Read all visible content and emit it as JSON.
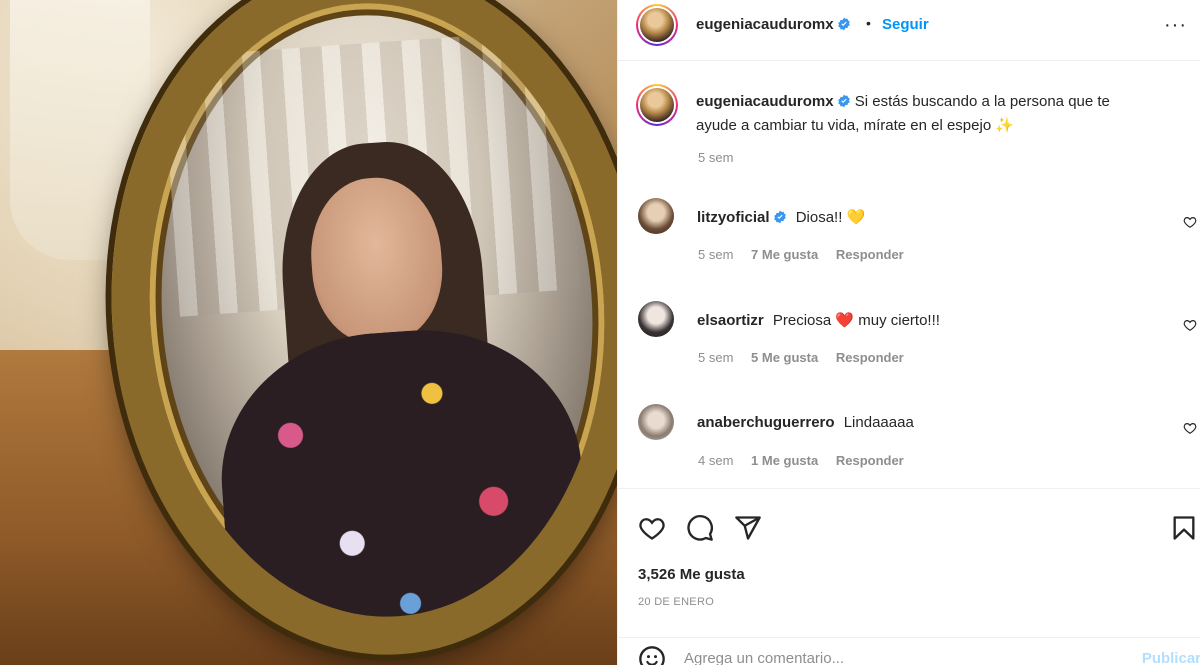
{
  "post": {
    "username": "eugeniacauduromx",
    "follow_label": "Seguir",
    "separator": "•",
    "more_label": "···",
    "caption_text": "Si estás buscando a la persona que te ayude a cambiar tu vida, mírate en el espejo ✨",
    "caption_time": "5 sem",
    "likes": "3,526 Me gusta",
    "date": "20 DE ENERO"
  },
  "comments": [
    {
      "username": "litzyoficial",
      "verified": true,
      "text": "Diosa!! 💛",
      "time": "5 sem",
      "likes": "7 Me gusta",
      "reply": "Responder",
      "avatar_color": "#d9c2a8"
    },
    {
      "username": "elsaortizr",
      "verified": false,
      "text": "Preciosa ❤️ muy cierto!!!",
      "time": "5 sem",
      "likes": "5 Me gusta",
      "reply": "Responder",
      "avatar_color": "#c9c9c9"
    },
    {
      "username": "anaberchuguerrero",
      "verified": false,
      "text": "Lindaaaaa",
      "time": "4 sem",
      "likes": "1 Me gusta",
      "reply": "Responder",
      "avatar_color": "#d6d2ce"
    }
  ],
  "composer": {
    "placeholder": "Agrega un comentario...",
    "post_label": "Publicar"
  },
  "colors": {
    "accent": "#0095f6",
    "verified": "#3897f0",
    "muted": "#8e8e8e"
  },
  "icons": [
    "verified-badge-icon",
    "more-icon",
    "heart-icon",
    "comment-icon",
    "share-icon",
    "bookmark-icon",
    "emoji-icon"
  ]
}
